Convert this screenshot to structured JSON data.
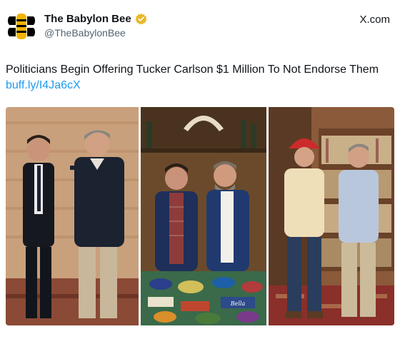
{
  "account": {
    "display_name": "The Babylon Bee",
    "handle": "@TheBabylonBee",
    "avatar_icon": "bee-logo-icon",
    "verified_icon": "verified-badge-icon",
    "verified_color": "#e8b828"
  },
  "source": {
    "label": "X.com"
  },
  "post": {
    "text": "Politicians Begin Offering Tucker Carlson $1 Million To Not Endorse Them",
    "link": "buff.ly/I4Ja6cX",
    "link_color": "#1d9bf0"
  },
  "media": {
    "photos": [
      {
        "icon": "photo-two-men-wooden-wall"
      },
      {
        "icon": "photo-two-men-cabin-table"
      },
      {
        "icon": "photo-two-men-bookshelf"
      }
    ],
    "table_sticker_label": "Bella"
  }
}
